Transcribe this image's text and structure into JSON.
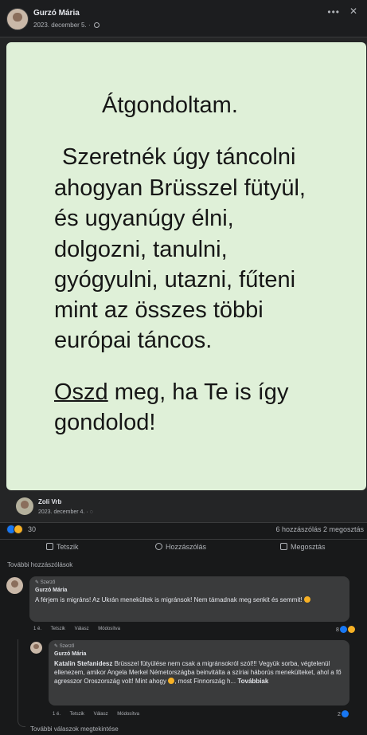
{
  "post": {
    "author": "Gurzó Mária",
    "date": "2023. december 5.",
    "more_icon": "ellipsis-icon",
    "close_icon": "close-icon"
  },
  "card": {
    "background": "#dff0d8",
    "lines": [
      "Átgondoltam.",
      "Szeretnék úgy táncolni",
      "ahogyan Brüsszel fütyül,",
      "és ugyanúgy élni,",
      "dolgozni, tanulni,",
      "gyógyulni, utazni, fűteni",
      "mint az összes többi",
      "európai táncos.",
      "meg, ha Te is így",
      "gondolod!"
    ],
    "underlined_word": "Oszd"
  },
  "original_post": {
    "author": "Zoli Vrb",
    "date": "2023. december 4."
  },
  "stats": {
    "reaction_count": "30",
    "comments_shares": "6 hozzászólás  2 megosztás"
  },
  "actions": {
    "like": "Tetszik",
    "comment": "Hozzászólás",
    "share": "Megosztás"
  },
  "more_comments": "További hozzászólások",
  "comments": [
    {
      "tag": "Szerző",
      "author": "Gurzó Mária",
      "text": "A férjem is migráns! Az Ukrán menekültek is migránsok! Nem támadnak meg senkit és semmit!",
      "time": "1 é.",
      "like": "Tetszik",
      "reply": "Válasz",
      "edited": "Módosítva",
      "reaction_count": "8"
    },
    {
      "tag": "Szerző",
      "author": "Gurzó Mária",
      "mention": "Katalin Stefanidesz",
      "text": "Brüsszel fütyülése nem csak a migránsokról szól!!! Vegyük sorba, végtelenül ellenezem, amikor Angela Merkel Németországba beinvitálta a szíriai háborús menekülteket, ahol a fő agresszor Oroszország volt! Mint ahogy",
      "text_end": ", most Finnország h...",
      "see_more": "Továbbiak",
      "time": "1 é.",
      "like": "Tetszik",
      "reply": "Válasz",
      "edited": "Módosítva",
      "reaction_count": "2"
    }
  ],
  "more_replies": "További válaszok megtekintése"
}
